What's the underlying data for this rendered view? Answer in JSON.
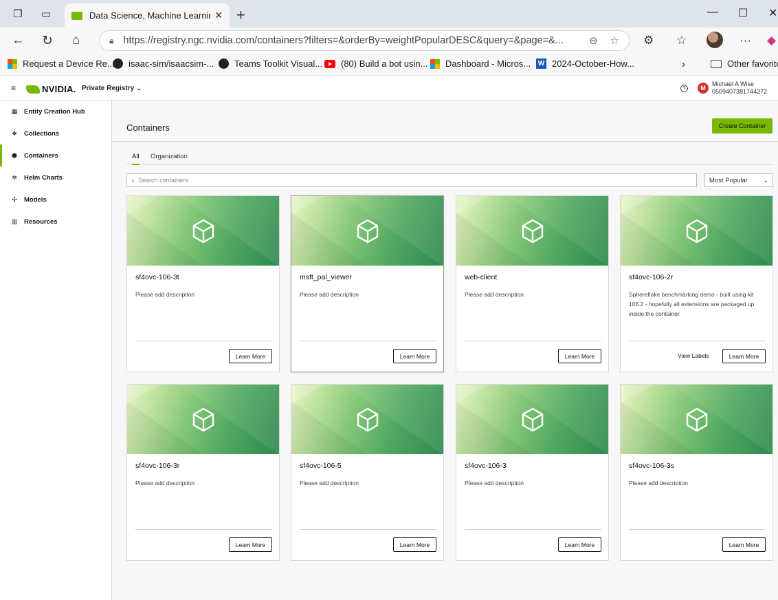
{
  "browser": {
    "tab_title": "Data Science, Machine Learning, A",
    "url": "https://registry.ngc.nvidia.com/containers?filters=&orderBy=weightPopularDESC&query=&page=&...",
    "bookmarks": [
      "Request a Device Re...",
      "isaac-sim/isaacsim-...",
      "Teams Toolkit Visual...",
      "(80) Build a bot usin...",
      "Dashboard - Micros...",
      "2024-October-How...",
      "Other favorites"
    ]
  },
  "header": {
    "brand": "NVIDIA.",
    "registry": "Private Registry ⌄",
    "user_name": "Michael A Wise",
    "user_id": "0509407381744272",
    "avatar_initial": "M"
  },
  "sidebar": {
    "items": [
      {
        "label": "Entity Creation Hub",
        "icon": "grid-icon"
      },
      {
        "label": "Collections",
        "icon": "collections-icon"
      },
      {
        "label": "Containers",
        "icon": "container-icon"
      },
      {
        "label": "Helm Charts",
        "icon": "helm-icon"
      },
      {
        "label": "Models",
        "icon": "models-icon"
      },
      {
        "label": "Resources",
        "icon": "resources-icon"
      }
    ],
    "active_index": 2
  },
  "main": {
    "title": "Containers",
    "create_label": "Create Container",
    "tabs": [
      "All",
      "Organization"
    ],
    "search_placeholder": "Search containers...",
    "sort_value": "Most Popular",
    "learn_more": "Learn More",
    "view_labels": "View Labels"
  },
  "cards": [
    {
      "name": "sf4ovc-106-3t",
      "desc": "Please add description"
    },
    {
      "name": "msft_pal_viewer",
      "desc": "Please add description"
    },
    {
      "name": "web-client",
      "desc": "Please add description"
    },
    {
      "name": "sf4ovc-106-2r",
      "desc": "Sphereflake benchmarking demo - built using kit 106.2 - hopefully all extensions are packaged up inside the container"
    },
    {
      "name": "sf4ovc-106-3r",
      "desc": "Please add description"
    },
    {
      "name": "sf4ovc-106-5",
      "desc": "Please add description"
    },
    {
      "name": "sf4ovc-106-3",
      "desc": "Please add description"
    },
    {
      "name": "sf4ovc-106-3s",
      "desc": "Please add description"
    }
  ],
  "colors": {
    "accent": "#76b900",
    "avatar": "#d32f2f"
  }
}
